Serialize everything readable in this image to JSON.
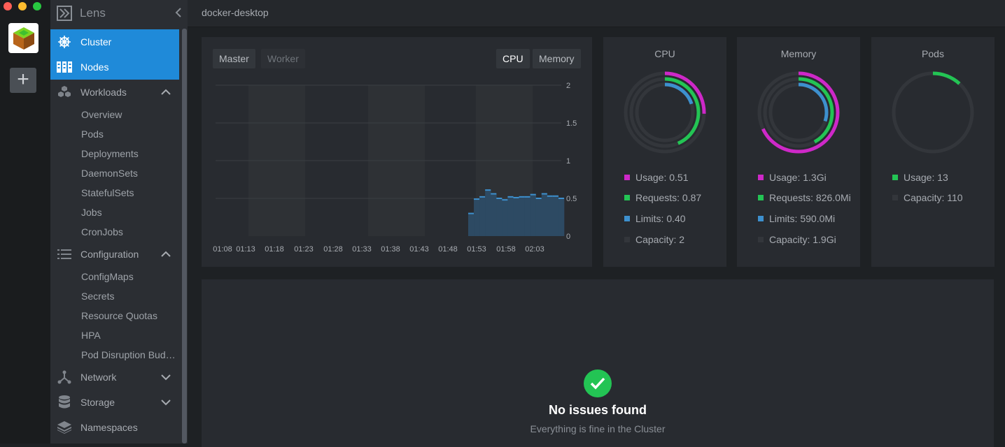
{
  "window": {
    "title": "docker-desktop"
  },
  "app": {
    "name": "Lens"
  },
  "rail": {
    "add_label": "+"
  },
  "sidebar": {
    "cluster_label": "Cluster",
    "nodes_label": "Nodes",
    "workloads_label": "Workloads",
    "workloads_items": [
      "Overview",
      "Pods",
      "Deployments",
      "DaemonSets",
      "StatefulSets",
      "Jobs",
      "CronJobs"
    ],
    "configuration_label": "Configuration",
    "configuration_items": [
      "ConfigMaps",
      "Secrets",
      "Resource Quotas",
      "HPA",
      "Pod Disruption Budg..."
    ],
    "network_label": "Network",
    "storage_label": "Storage",
    "namespaces_label": "Namespaces"
  },
  "chart_controls": {
    "master_label": "Master",
    "worker_label": "Worker",
    "cpu_label": "CPU",
    "memory_label": "Memory",
    "selected_node": "Master",
    "selected_metric": "CPU"
  },
  "chart_data": {
    "type": "area",
    "title": "",
    "xlabel": "",
    "ylabel": "",
    "ylim": [
      0,
      2
    ],
    "yticks": [
      "2",
      "1.5",
      "1",
      "0.5",
      "0"
    ],
    "x_tick_labels": [
      "01:08",
      "01:13",
      "01:18",
      "01:23",
      "01:28",
      "01:33",
      "01:38",
      "01:43",
      "01:48",
      "01:53",
      "01:58",
      "02:03"
    ],
    "series": [
      {
        "values": [
          0.3,
          0.49,
          0.52,
          0.61,
          0.56,
          0.5,
          0.48,
          0.52,
          0.51,
          0.52,
          0.52,
          0.55,
          0.5,
          0.56,
          0.53,
          0.53,
          0.5
        ]
      }
    ],
    "color": "#3d90ce",
    "grid": true
  },
  "cpu": {
    "title": "CPU",
    "usage": "Usage: 0.51",
    "requests": "Requests: 0.87",
    "limits": "Limits: 0.40",
    "capacity": "Capacity: 2",
    "ring_fraction": {
      "usage": 0.255,
      "requests": 0.435,
      "limits": 0.2
    }
  },
  "memory": {
    "title": "Memory",
    "usage": "Usage: 1.3Gi",
    "requests": "Requests: 826.0Mi",
    "limits": "Limits: 590.0Mi",
    "capacity": "Capacity: 1.9Gi",
    "ring_fraction": {
      "usage": 0.68,
      "requests": 0.42,
      "limits": 0.3
    }
  },
  "pods": {
    "title": "Pods",
    "usage": "Usage: 13",
    "capacity": "Capacity: 110",
    "ring_fraction": {
      "usage": 0.118
    }
  },
  "colors": {
    "usage": "#ce28c8",
    "requests": "#23c454",
    "limits": "#3d90ce",
    "capacity": "#33363b",
    "accent": "#1f8ad9"
  },
  "issues": {
    "title": "No issues found",
    "subtitle": "Everything is fine in the Cluster"
  }
}
